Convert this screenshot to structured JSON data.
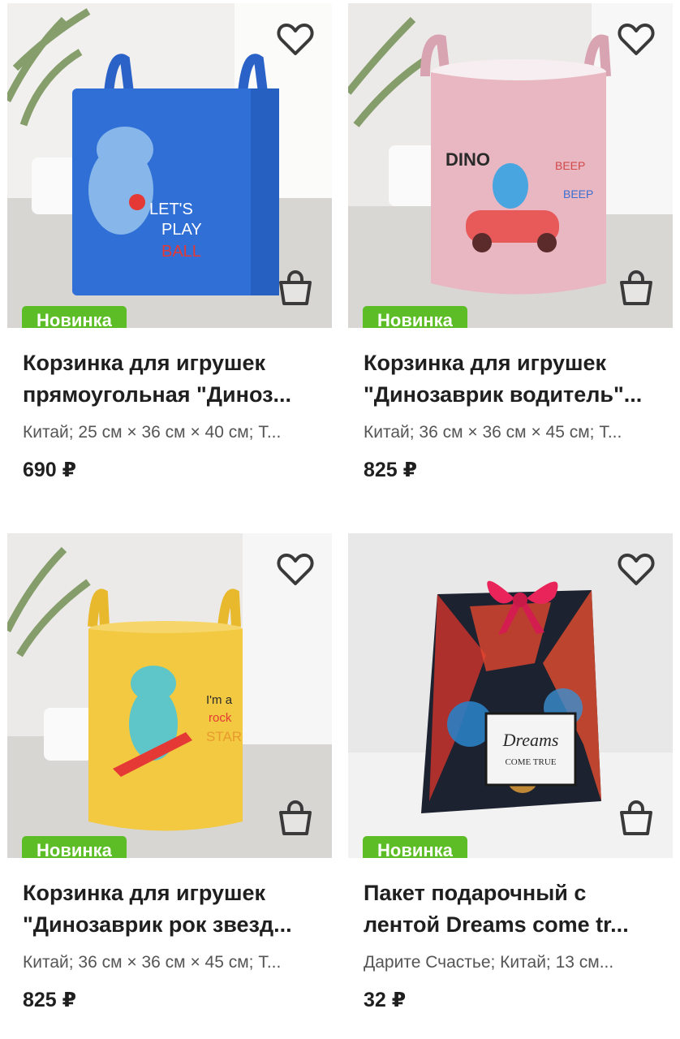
{
  "products": [
    {
      "badge": "Новинка",
      "title": "Корзинка для игрушек прямоугольная \"Диноз...",
      "desc": "Китай; 25 см × 36 см × 40 см; Т...",
      "price": "690 ₽",
      "image_text": [
        "LET'S",
        "PLAY",
        "BALL"
      ],
      "favorite_icon": "heart-outline-icon",
      "cart_icon": "shopping-bag-icon"
    },
    {
      "badge": "Новинка",
      "title": "Корзинка для игрушек \"Динозаврик водитель\"...",
      "desc": "Китай; 36 см × 36 см × 45 см; Т...",
      "price": "825 ₽",
      "image_text": [
        "DINO",
        "BEEP",
        "BEEP"
      ],
      "favorite_icon": "heart-outline-icon",
      "cart_icon": "shopping-bag-icon"
    },
    {
      "badge": "Новинка",
      "title": "Корзинка для игрушек \"Динозаврик рок звезд...",
      "desc": "Китай; 36 см × 36 см × 45 см; Т...",
      "price": "825 ₽",
      "image_text": [
        "I'm a",
        "rock",
        "STAR"
      ],
      "favorite_icon": "heart-outline-icon",
      "cart_icon": "shopping-bag-icon"
    },
    {
      "badge": "Новинка",
      "title": "Пакет подарочный с лентой Dreams come tr...",
      "desc": "Дарите Счастье; Китай; 13 см...",
      "price": "32 ₽",
      "image_text": [
        "Dreams",
        "COME TRUE"
      ],
      "favorite_icon": "heart-outline-icon",
      "cart_icon": "shopping-bag-icon"
    }
  ],
  "colors": {
    "badge": "#5dbd26",
    "blue_basket": "#2f6fd6",
    "pink_basket": "#e8b7c2",
    "yellow_basket": "#f2c940",
    "ribbon": "#e8245a"
  }
}
